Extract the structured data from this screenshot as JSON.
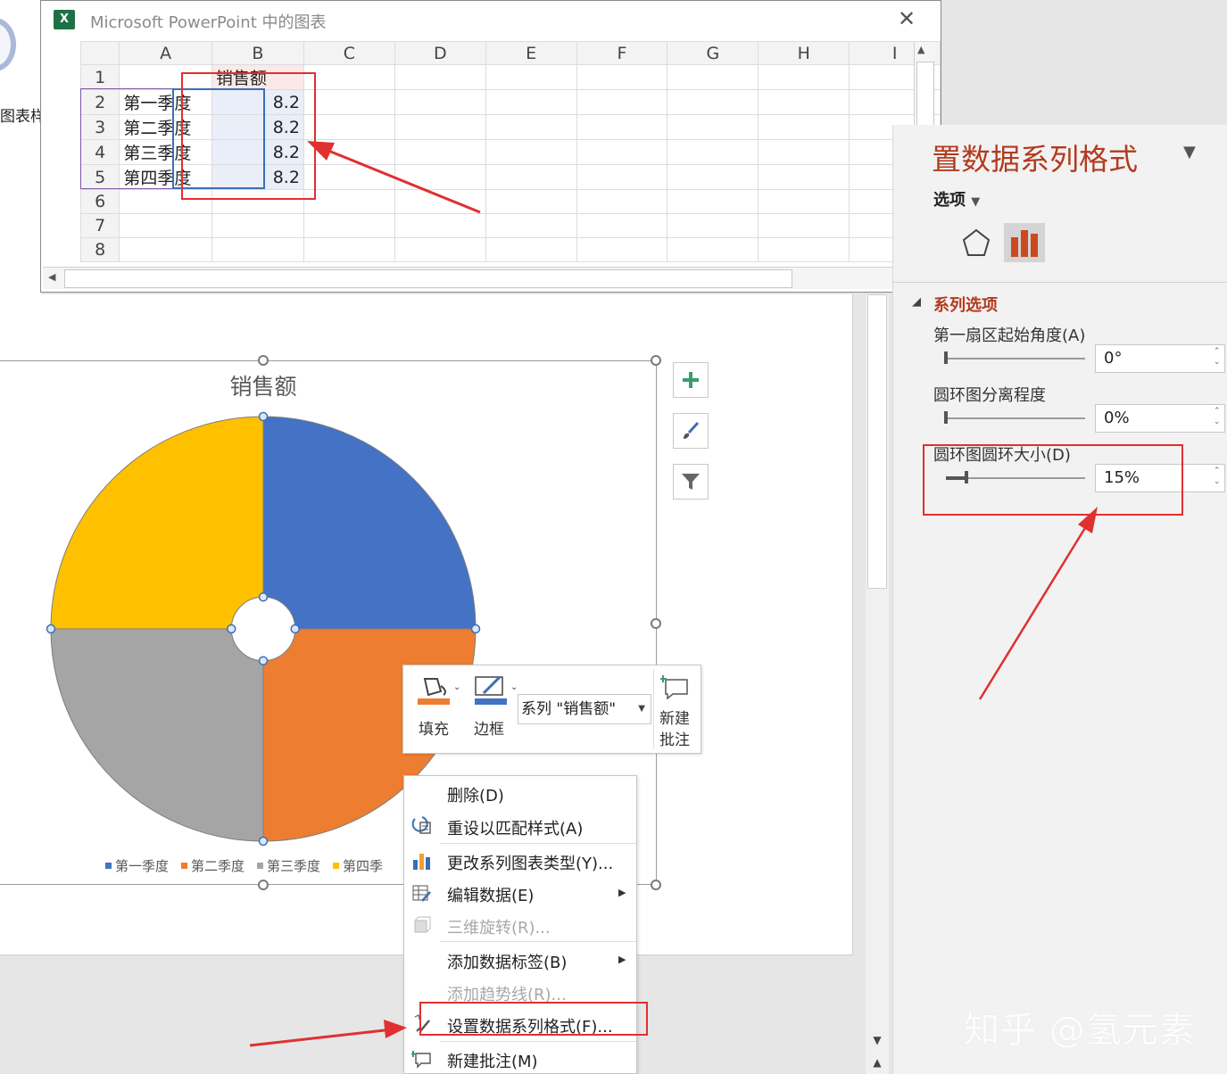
{
  "background": {
    "chart_styles_label": "图表样"
  },
  "excel": {
    "title": "Microsoft PowerPoint 中的图表",
    "icon": "excel-icon",
    "columns": [
      "A",
      "B",
      "C",
      "D",
      "E",
      "F",
      "G",
      "H",
      "I"
    ],
    "rows": [
      {
        "n": "1",
        "a": "",
        "b": "销售额"
      },
      {
        "n": "2",
        "a": "第一季度",
        "b": "8.2"
      },
      {
        "n": "3",
        "a": "第二季度",
        "b": "8.2"
      },
      {
        "n": "4",
        "a": "第三季度",
        "b": "8.2"
      },
      {
        "n": "5",
        "a": "第四季度",
        "b": "8.2"
      },
      {
        "n": "6",
        "a": "",
        "b": ""
      },
      {
        "n": "7",
        "a": "",
        "b": ""
      },
      {
        "n": "8",
        "a": "",
        "b": ""
      }
    ]
  },
  "chart": {
    "legend_tail": "第四季"
  },
  "chart_data": {
    "type": "pie",
    "subtype": "doughnut",
    "title": "销售额",
    "categories": [
      "第一季度",
      "第二季度",
      "第三季度",
      "第四季度"
    ],
    "series": [
      {
        "name": "销售额",
        "values": [
          8.2,
          8.2,
          8.2,
          8.2
        ]
      }
    ],
    "colors": [
      "#4472c4",
      "#ed7d31",
      "#a5a5a5",
      "#ffc000"
    ],
    "hole_size_percent": 15,
    "legend_position": "bottom"
  },
  "mini_toolbar": {
    "fill_label": "填充",
    "border_label": "边框",
    "series_select": "系列 \"销售额\"",
    "new_comment_label_1": "新建",
    "new_comment_label_2": "批注",
    "fill_color": "#ed7d31",
    "border_color": "#4472c4"
  },
  "context_menu": {
    "items": [
      {
        "label": "删除(D)",
        "disabled": false
      },
      {
        "label": "重设以匹配样式(A)",
        "disabled": false
      },
      {
        "label": "更改系列图表类型(Y)...",
        "disabled": false
      },
      {
        "label": "编辑数据(E)",
        "disabled": false
      },
      {
        "label": "三维旋转(R)...",
        "disabled": true
      },
      {
        "label": "添加数据标签(B)",
        "disabled": false
      },
      {
        "label": "添加趋势线(R)...",
        "disabled": true
      },
      {
        "label": "设置数据系列格式(F)...",
        "disabled": false
      },
      {
        "label": "新建批注(M)",
        "disabled": false
      }
    ]
  },
  "format_pane": {
    "title": "置数据系列格式",
    "options_label": "选项",
    "section_label": "系列选项",
    "first_slice_angle_label": "第一扇区起始角度(A)",
    "first_slice_angle_value": "0°",
    "first_slice_angle_fraction": 0,
    "explosion_label": "圆环图分离程度",
    "explosion_value": "0%",
    "explosion_fraction": 0,
    "hole_size_label": "圆环图圆环大小(D)",
    "hole_size_value": "15%",
    "hole_size_fraction": 0.15,
    "title_color": "#b33a1e"
  },
  "watermark": "知乎 @氢元素"
}
